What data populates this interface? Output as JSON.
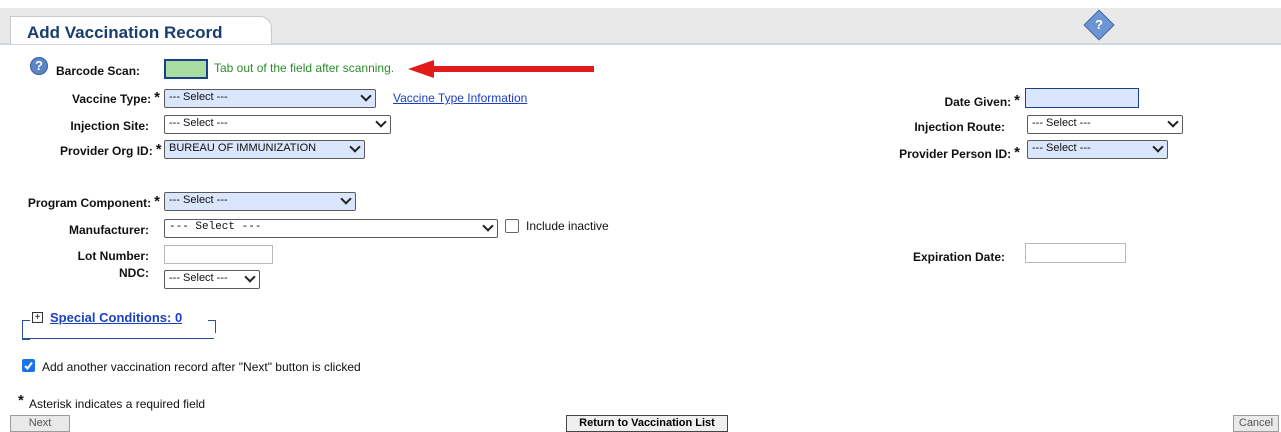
{
  "header": {
    "title": "Add Vaccination Record",
    "help_label": "?"
  },
  "form": {
    "barcode": {
      "label": "Barcode Scan:",
      "hint": "Tab out of the field after scanning.",
      "value": ""
    },
    "vaccine_type": {
      "label": "Vaccine Type:",
      "value": "--- Select ---",
      "link": "Vaccine Type Information"
    },
    "date_given": {
      "label": "Date Given:",
      "value": ""
    },
    "injection_site": {
      "label": "Injection Site:",
      "value": "--- Select ---"
    },
    "injection_route": {
      "label": "Injection Route:",
      "value": "--- Select ---"
    },
    "provider_org": {
      "label": "Provider Org ID:",
      "value": "BUREAU OF IMMUNIZATION"
    },
    "provider_person": {
      "label": "Provider Person ID:",
      "value": "--- Select ---"
    },
    "program_component": {
      "label": "Program Component:",
      "value": "--- Select ---"
    },
    "manufacturer": {
      "label": "Manufacturer:",
      "value": "--- Select ---",
      "include_inactive_label": "Include inactive",
      "include_inactive_checked": false
    },
    "lot_number": {
      "label": "Lot Number:",
      "value": ""
    },
    "expiration_date": {
      "label": "Expiration Date:",
      "value": ""
    },
    "ndc": {
      "label": "NDC:",
      "value": "--- Select ---"
    },
    "required_marker": "*"
  },
  "special_conditions": {
    "label": "Special Conditions: 0",
    "expander": "+"
  },
  "add_another": {
    "label": "Add another vaccination record after \"Next\" button is clicked",
    "checked": true
  },
  "footnote": {
    "star": "*",
    "text": "Asterisk indicates a required field"
  },
  "buttons": {
    "next": "Next",
    "return": "Return to Vaccination List",
    "cancel": "Cancel"
  },
  "colors": {
    "arrow": "#e11b1b",
    "required_field": "#d9e6fb",
    "title": "#1a3d6e",
    "link": "#1c3fbf",
    "hint": "#2d8a2d"
  },
  "icons": {
    "help": "question-circle-icon",
    "header_help": "question-diamond-icon",
    "arrow": "red-arrow-icon"
  }
}
